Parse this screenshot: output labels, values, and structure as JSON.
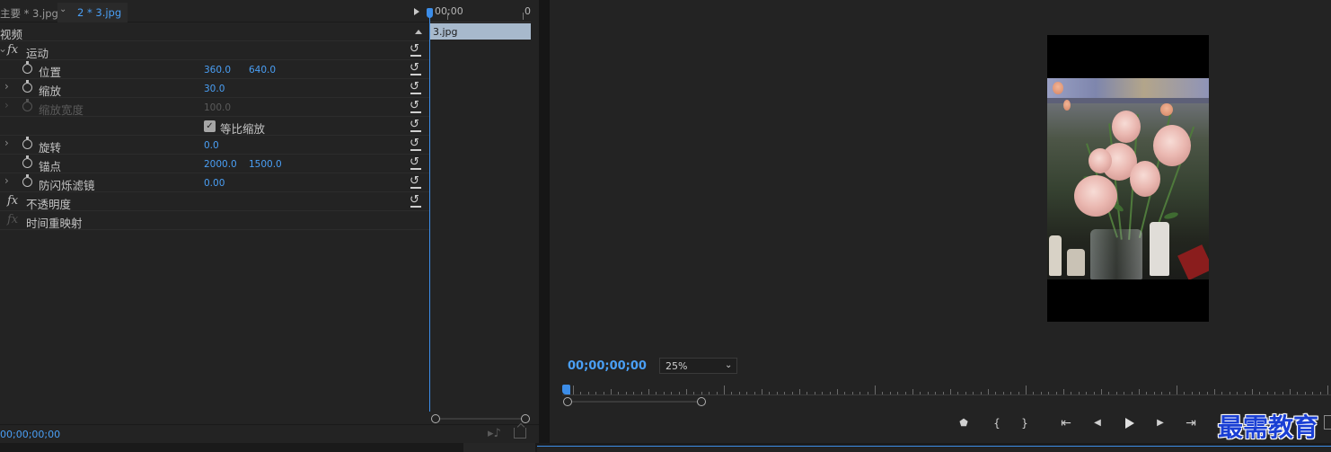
{
  "effect_controls": {
    "tab_master": "主要 * 3.jpg",
    "tab_clip": "2 * 3.jpg",
    "section_video": "视频",
    "motion": {
      "label": "运动",
      "position": {
        "label": "位置",
        "x": "360.0",
        "y": "640.0"
      },
      "scale": {
        "label": "缩放",
        "value": "30.0"
      },
      "scale_width": {
        "label": "缩放宽度",
        "value": "100.0"
      },
      "uniform_scale": {
        "label": "等比缩放",
        "checked": true
      },
      "rotation": {
        "label": "旋转",
        "value": "0.0"
      },
      "anchor": {
        "label": "锚点",
        "x": "2000.0",
        "y": "1500.0"
      },
      "anti_flicker": {
        "label": "防闪烁滤镜",
        "value": "0.00"
      }
    },
    "opacity": {
      "label": "不透明度"
    },
    "time_remap": {
      "label": "时间重映射"
    },
    "timeline": {
      "start_tc": "00;00",
      "end_tc": "0",
      "clip_name": "3.jpg"
    },
    "footer_timecode": "00;00;00;00"
  },
  "program_monitor": {
    "timecode": "00;00;00;00",
    "zoom": {
      "value": "25%",
      "options_visible": [
        "25%"
      ]
    },
    "controls": [
      "add-marker",
      "mark-in",
      "mark-out",
      "go-to-in",
      "step-back",
      "play",
      "step-forward",
      "go-to-out"
    ],
    "control_glyphs": {
      "marker": "⬟",
      "mark_in": "{",
      "mark_out": "}",
      "go_in": "⇤",
      "step_back": "◀",
      "step_fwd": "▶",
      "go_out": "⇥"
    }
  },
  "watermark": "最需教育",
  "colors": {
    "accent_blue": "#4a9ff5",
    "playhead": "#3c8de8",
    "clip_bar": "#a7b9cc",
    "panel_bg": "#232323"
  }
}
